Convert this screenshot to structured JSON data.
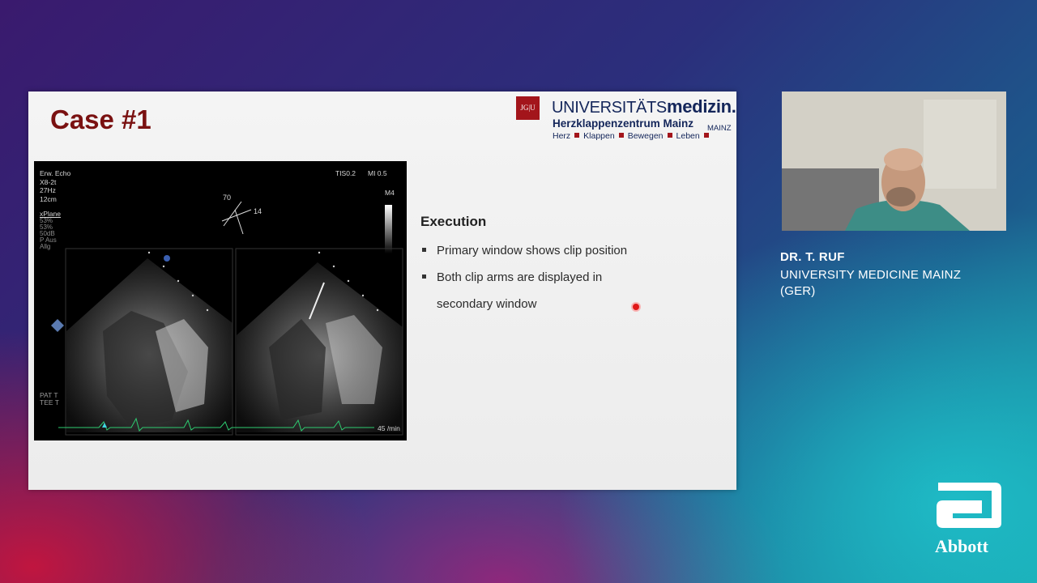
{
  "slide": {
    "title": "Case #1",
    "logo": {
      "seal": "JG|U",
      "uni_prefix": "UNIVERSITÄTS",
      "uni_bold": "medizin.",
      "zentrum": "Herzklappenzentrum Mainz",
      "mainz": "MAINZ",
      "tags": [
        "Herz",
        "Klappen",
        "Bewegen",
        "Leben"
      ]
    },
    "echo": {
      "mode": "Erw. Echo",
      "probe": "X8-2t",
      "freq": "27Hz",
      "depth": "12cm",
      "xplane": "xPlane",
      "tis": "TIS0.2",
      "mi": "MI 0.5",
      "m4": "M4",
      "angle_primary": "70",
      "angle_secondary": "14",
      "pat_t": "PAT T",
      "tee_t": "TEE T",
      "rate": "45 /min"
    },
    "heading": "Execution",
    "bullets": [
      "Primary window shows clip position",
      "Both clip arms are displayed in"
    ],
    "bullet_continuation": "secondary window"
  },
  "speaker": {
    "name": "DR. T. RUF",
    "institution": "UNIVERSITY MEDICINE MAINZ",
    "country": "(GER)"
  },
  "brand": {
    "name": "Abbott",
    "icon": "abbott-logo-icon"
  },
  "colors": {
    "title": "#7a1111",
    "accent_red": "#a3151b",
    "navy": "#14265a",
    "ecg": "#2ecc71"
  }
}
